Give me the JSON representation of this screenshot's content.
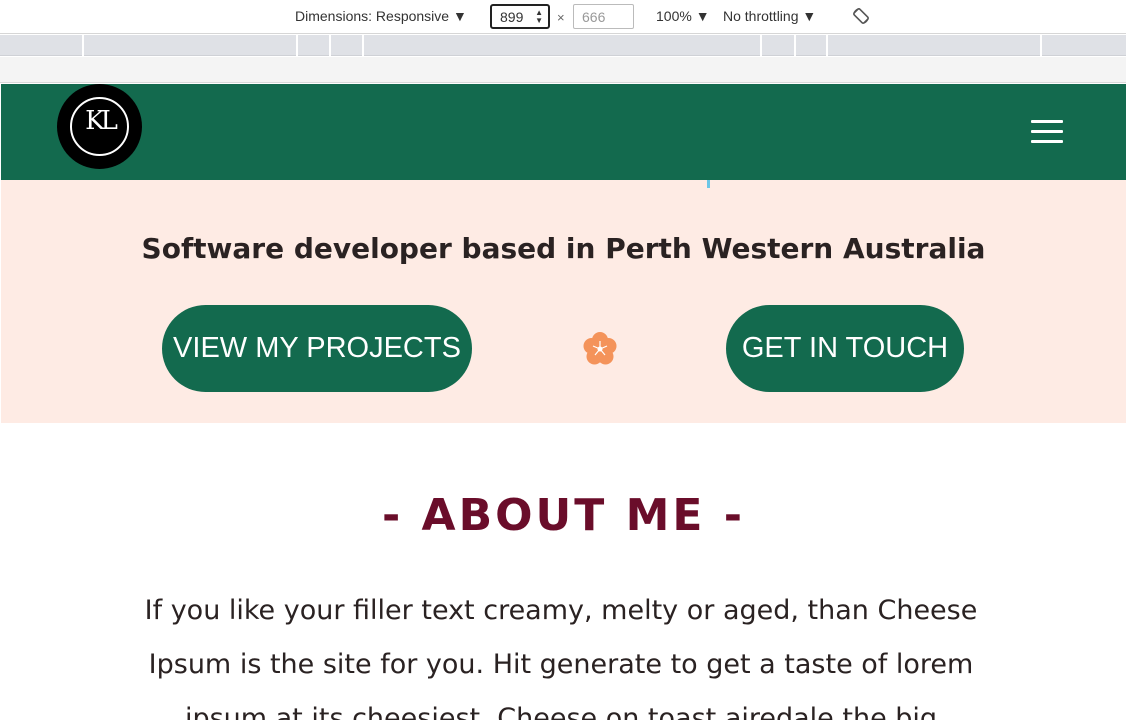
{
  "devtools": {
    "dimensions_label": "Dimensions: Responsive ▼",
    "width_value": "899",
    "times": "×",
    "height_placeholder": "666",
    "zoom": "100% ▼",
    "throttling": "No throttling ▼"
  },
  "nav": {
    "logo_text": "KL"
  },
  "hero": {
    "title": "Software developer based in Perth Western Australia",
    "projects_button": "VIEW MY PROJECTS",
    "touch_button": "GET IN TOUCH"
  },
  "about": {
    "title": "- ABOUT ME -",
    "text": "If you like your filler text creamy, melty or aged, than Cheese Ipsum is the site for you. Hit generate to get a taste of lorem ipsum at its cheesiest. Cheese on toast airedale the big"
  },
  "colors": {
    "brand_green": "#136a4e",
    "hero_bg": "#feebe4",
    "about_title": "#6a0d2a",
    "flower": "#f4935a"
  }
}
